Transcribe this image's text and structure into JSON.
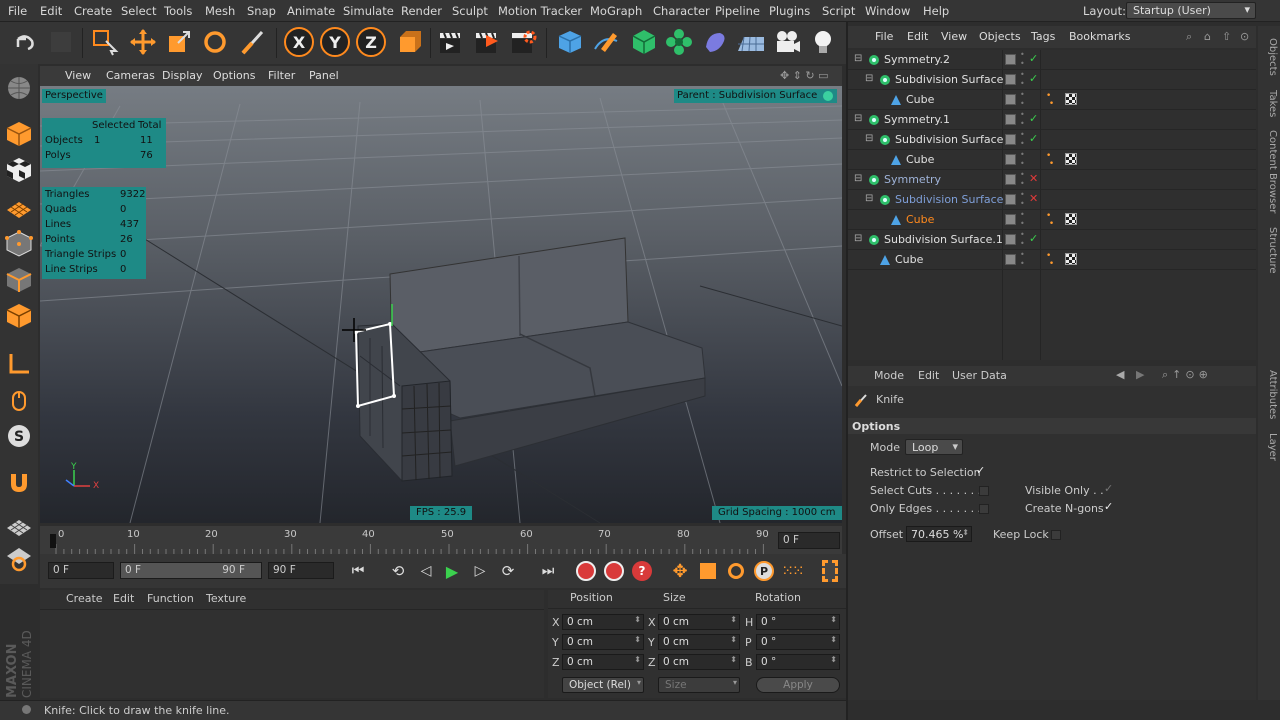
{
  "menubar": {
    "items": [
      "File",
      "Edit",
      "Create",
      "Select",
      "Tools",
      "Mesh",
      "Snap",
      "Animate",
      "Simulate",
      "Render",
      "Sculpt",
      "Motion Tracker",
      "MoGraph",
      "Character",
      "Pipeline",
      "Plugins",
      "Script",
      "Window",
      "Help"
    ],
    "layout_label": "Layout:",
    "layout_value": "Startup (User)"
  },
  "viewport": {
    "menu": [
      "View",
      "Cameras",
      "Display",
      "Options",
      "Filter",
      "Panel"
    ],
    "camera_label": "Perspective",
    "parent_label": "Parent : Subdivision Surface",
    "fps": "FPS : 25.9",
    "grid_spacing": "Grid Spacing : 1000 cm",
    "stats": {
      "selected_header": "Selected",
      "total_header": "Total",
      "objects_label": "Objects",
      "objects_selected": "1",
      "objects_total": "11",
      "polys_label": "Polys",
      "polys_total": "76"
    },
    "counts": [
      {
        "label": "Triangles",
        "value": "9322"
      },
      {
        "label": "Quads",
        "value": "0"
      },
      {
        "label": "Lines",
        "value": "437"
      },
      {
        "label": "Points",
        "value": "26"
      },
      {
        "label": "Triangle Strips",
        "value": "0"
      },
      {
        "label": "Line Strips",
        "value": "0"
      }
    ],
    "axis_y": "Y",
    "axis_x": "X"
  },
  "timeline": {
    "ticks": [
      "0",
      "10",
      "20",
      "30",
      "40",
      "50",
      "60",
      "70",
      "80",
      "90"
    ],
    "current_frame": "0 F"
  },
  "transport": {
    "start": "0 F",
    "range_start": "0 F",
    "range_end": "90 F",
    "end": "90 F"
  },
  "material_manager": {
    "menu": [
      "Create",
      "Edit",
      "Function",
      "Texture"
    ]
  },
  "coordinates": {
    "headers": {
      "position": "Position",
      "size": "Size",
      "rotation": "Rotation"
    },
    "rows": [
      {
        "pos_axis": "X",
        "pos": "0 cm",
        "size_axis": "X",
        "size": "0 cm",
        "rot_axis": "H",
        "rot": "0 °"
      },
      {
        "pos_axis": "Y",
        "pos": "0 cm",
        "size_axis": "Y",
        "size": "0 cm",
        "rot_axis": "P",
        "rot": "0 °"
      },
      {
        "pos_axis": "Z",
        "pos": "0 cm",
        "size_axis": "Z",
        "size": "0 cm",
        "rot_axis": "B",
        "rot": "0 °"
      }
    ],
    "mode": "Object (Rel)",
    "size_mode": "Size",
    "apply": "Apply"
  },
  "status": {
    "text": "Knife: Click to draw the knife line."
  },
  "object_manager": {
    "menu": [
      "File",
      "Edit",
      "View",
      "Objects",
      "Tags",
      "Bookmarks"
    ],
    "rows": [
      {
        "name": "Symmetry.2",
        "indent": 0,
        "type": "symmetry",
        "state": "check",
        "tags": false,
        "color": "#e0e0e0"
      },
      {
        "name": "Subdivision Surface",
        "indent": 1,
        "type": "subd",
        "state": "check",
        "tags": false,
        "color": "#e0e0e0"
      },
      {
        "name": "Cube",
        "indent": 2,
        "type": "cube",
        "state": "none",
        "tags": true,
        "color": "#e0e0e0"
      },
      {
        "name": "Symmetry.1",
        "indent": 0,
        "type": "symmetry",
        "state": "check",
        "tags": false,
        "color": "#e0e0e0"
      },
      {
        "name": "Subdivision Surface",
        "indent": 1,
        "type": "subd",
        "state": "check",
        "tags": false,
        "color": "#e0e0e0"
      },
      {
        "name": "Cube",
        "indent": 2,
        "type": "cube",
        "state": "none",
        "tags": true,
        "color": "#e0e0e0"
      },
      {
        "name": "Symmetry",
        "indent": 0,
        "type": "symmetry",
        "state": "cross",
        "tags": false,
        "color": "#9fb3d8"
      },
      {
        "name": "Subdivision Surface",
        "indent": 1,
        "type": "subd",
        "state": "cross",
        "tags": false,
        "color": "#7f9fd8"
      },
      {
        "name": "Cube",
        "indent": 2,
        "type": "cube",
        "state": "none",
        "tags": true,
        "color": "#ff8a1e"
      },
      {
        "name": "Subdivision Surface.1",
        "indent": 0,
        "type": "subd",
        "state": "check",
        "tags": false,
        "color": "#e0e0e0"
      },
      {
        "name": "Cube",
        "indent": 1,
        "type": "cube",
        "state": "none",
        "tags": true,
        "color": "#e0e0e0"
      }
    ]
  },
  "attributes": {
    "menu": [
      "Mode",
      "Edit",
      "User Data"
    ],
    "tool_name": "Knife",
    "section": "Options",
    "mode_label": "Mode",
    "mode_value": "Loop",
    "restrict": "Restrict to Selection",
    "select_cuts": "Select Cuts . . . . . . . .",
    "only_edges": "Only Edges . . . . . . . .",
    "visible_only": "Visible Only . .",
    "create_ngons": "Create N-gons",
    "offset_label": "Offset",
    "offset_value": "70.465 %",
    "keep_lock": "Keep Lock"
  },
  "right_tabs": [
    "Objects",
    "Takes",
    "Content Browser",
    "Structure",
    "Attributes",
    "Layer"
  ],
  "branding": {
    "line1": "MAXON",
    "line2": "CINEMA 4D"
  }
}
